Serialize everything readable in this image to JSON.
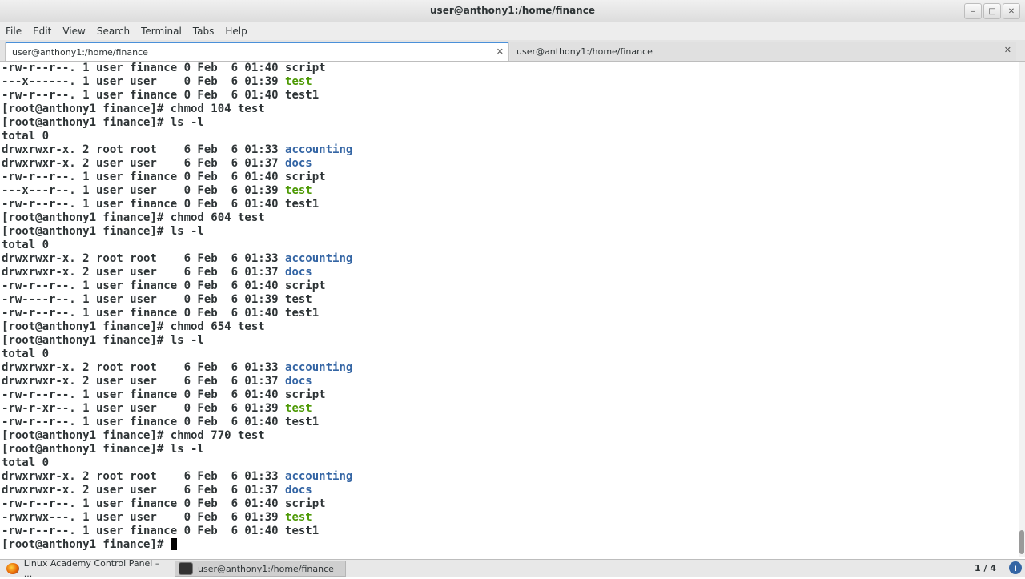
{
  "window": {
    "title": "user@anthony1:/home/finance"
  },
  "menu": [
    "File",
    "Edit",
    "View",
    "Search",
    "Terminal",
    "Tabs",
    "Help"
  ],
  "tabs": [
    {
      "label": "user@anthony1:/home/finance"
    },
    {
      "label": "user@anthony1:/home/finance"
    }
  ],
  "terminal": {
    "lines": [
      [
        [
          "-rw-r--r--. 1 user finance 0 Feb  6 01:40 ",
          ""
        ],
        [
          "script",
          ""
        ]
      ],
      [
        [
          "---x------. 1 user user    0 Feb  6 01:39 ",
          ""
        ],
        [
          "test",
          "green"
        ]
      ],
      [
        [
          "-rw-r--r--. 1 user finance 0 Feb  6 01:40 ",
          ""
        ],
        [
          "test1",
          ""
        ]
      ],
      [
        [
          "[root@anthony1 finance]# chmod 104 test",
          ""
        ]
      ],
      [
        [
          "[root@anthony1 finance]# ls -l",
          ""
        ]
      ],
      [
        [
          "total 0",
          ""
        ]
      ],
      [
        [
          "drwxrwxr-x. 2 root root    6 Feb  6 01:33 ",
          ""
        ],
        [
          "accounting",
          "blue"
        ]
      ],
      [
        [
          "drwxrwxr-x. 2 user user    6 Feb  6 01:37 ",
          ""
        ],
        [
          "docs",
          "blue"
        ]
      ],
      [
        [
          "-rw-r--r--. 1 user finance 0 Feb  6 01:40 ",
          ""
        ],
        [
          "script",
          ""
        ]
      ],
      [
        [
          "---x---r--. 1 user user    0 Feb  6 01:39 ",
          ""
        ],
        [
          "test",
          "green"
        ]
      ],
      [
        [
          "-rw-r--r--. 1 user finance 0 Feb  6 01:40 ",
          ""
        ],
        [
          "test1",
          ""
        ]
      ],
      [
        [
          "[root@anthony1 finance]# chmod 604 test",
          ""
        ]
      ],
      [
        [
          "[root@anthony1 finance]# ls -l",
          ""
        ]
      ],
      [
        [
          "total 0",
          ""
        ]
      ],
      [
        [
          "drwxrwxr-x. 2 root root    6 Feb  6 01:33 ",
          ""
        ],
        [
          "accounting",
          "blue"
        ]
      ],
      [
        [
          "drwxrwxr-x. 2 user user    6 Feb  6 01:37 ",
          ""
        ],
        [
          "docs",
          "blue"
        ]
      ],
      [
        [
          "-rw-r--r--. 1 user finance 0 Feb  6 01:40 ",
          ""
        ],
        [
          "script",
          ""
        ]
      ],
      [
        [
          "-rw----r--. 1 user user    0 Feb  6 01:39 ",
          ""
        ],
        [
          "test",
          ""
        ]
      ],
      [
        [
          "-rw-r--r--. 1 user finance 0 Feb  6 01:40 ",
          ""
        ],
        [
          "test1",
          ""
        ]
      ],
      [
        [
          "[root@anthony1 finance]# chmod 654 test",
          ""
        ]
      ],
      [
        [
          "[root@anthony1 finance]# ls -l",
          ""
        ]
      ],
      [
        [
          "total 0",
          ""
        ]
      ],
      [
        [
          "drwxrwxr-x. 2 root root    6 Feb  6 01:33 ",
          ""
        ],
        [
          "accounting",
          "blue"
        ]
      ],
      [
        [
          "drwxrwxr-x. 2 user user    6 Feb  6 01:37 ",
          ""
        ],
        [
          "docs",
          "blue"
        ]
      ],
      [
        [
          "-rw-r--r--. 1 user finance 0 Feb  6 01:40 ",
          ""
        ],
        [
          "script",
          ""
        ]
      ],
      [
        [
          "-rw-r-xr--. 1 user user    0 Feb  6 01:39 ",
          ""
        ],
        [
          "test",
          "green"
        ]
      ],
      [
        [
          "-rw-r--r--. 1 user finance 0 Feb  6 01:40 ",
          ""
        ],
        [
          "test1",
          ""
        ]
      ],
      [
        [
          "[root@anthony1 finance]# chmod 770 test",
          ""
        ]
      ],
      [
        [
          "[root@anthony1 finance]# ls -l",
          ""
        ]
      ],
      [
        [
          "total 0",
          ""
        ]
      ],
      [
        [
          "drwxrwxr-x. 2 root root    6 Feb  6 01:33 ",
          ""
        ],
        [
          "accounting",
          "blue"
        ]
      ],
      [
        [
          "drwxrwxr-x. 2 user user    6 Feb  6 01:37 ",
          ""
        ],
        [
          "docs",
          "blue"
        ]
      ],
      [
        [
          "-rw-r--r--. 1 user finance 0 Feb  6 01:40 ",
          ""
        ],
        [
          "script",
          ""
        ]
      ],
      [
        [
          "-rwxrwx---. 1 user user    0 Feb  6 01:39 ",
          ""
        ],
        [
          "test",
          "green"
        ]
      ],
      [
        [
          "-rw-r--r--. 1 user finance 0 Feb  6 01:40 ",
          ""
        ],
        [
          "test1",
          ""
        ]
      ],
      [
        [
          "[root@anthony1 finance]# ",
          ""
        ]
      ]
    ],
    "colors": {
      "blue": "#3465a4",
      "green": "#4e9a06",
      "text": "#2e3436"
    }
  },
  "taskbar": {
    "items": [
      {
        "label": "Linux Academy Control Panel – ...",
        "icon": "firefox-icon"
      },
      {
        "label": "user@anthony1:/home/finance",
        "icon": "terminal-icon"
      }
    ],
    "pager": "1 / 4"
  }
}
